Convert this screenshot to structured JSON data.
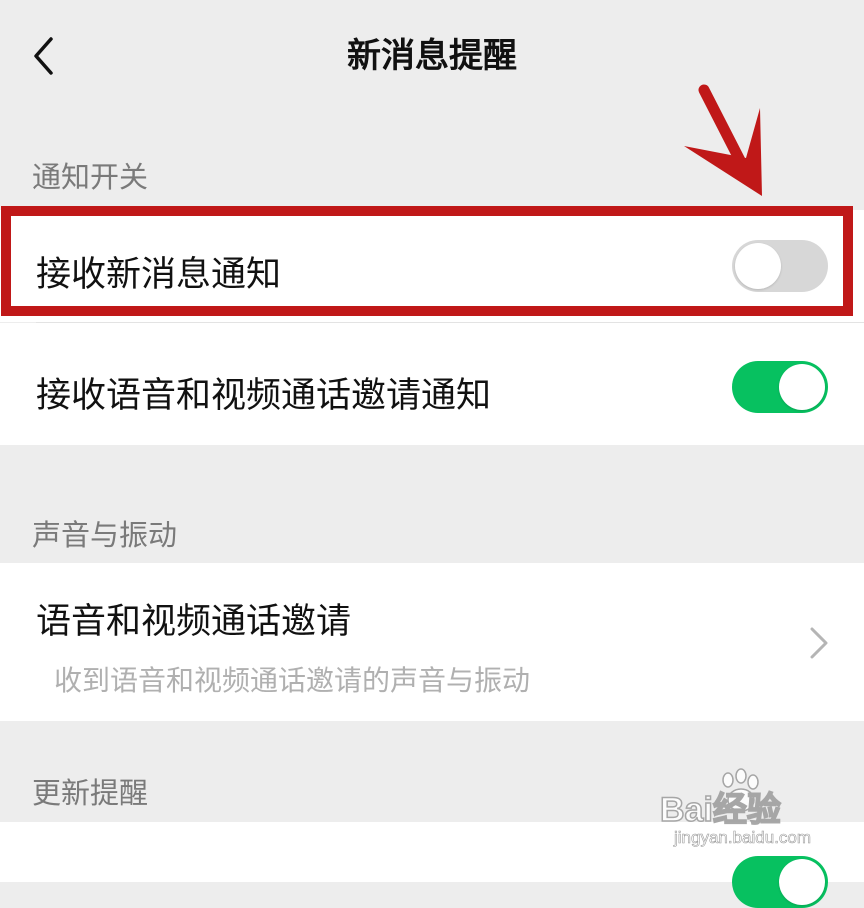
{
  "nav": {
    "title": "新消息提醒",
    "back_icon": "chevron-left-icon"
  },
  "sections": [
    {
      "header": "通知开关",
      "items": [
        {
          "label": "接收新消息通知",
          "toggle": "off"
        },
        {
          "label": "接收语音和视频通话邀请通知",
          "toggle": "on"
        }
      ]
    },
    {
      "header": "声音与振动",
      "items": [
        {
          "label": "语音和视频通话邀请",
          "subtitle": "收到语音和视频通话邀请的声音与振动",
          "icon": "chevron-right-icon"
        }
      ]
    },
    {
      "header": "更新提醒",
      "items": [
        {
          "toggle": "on"
        }
      ]
    }
  ],
  "colors": {
    "toggle_on": "#07c160",
    "toggle_off": "#d7d7d7",
    "highlight": "#c01818",
    "background": "#ededed"
  },
  "watermark": {
    "brand": "Bai经验",
    "url": "jingyan.baidu.com"
  }
}
